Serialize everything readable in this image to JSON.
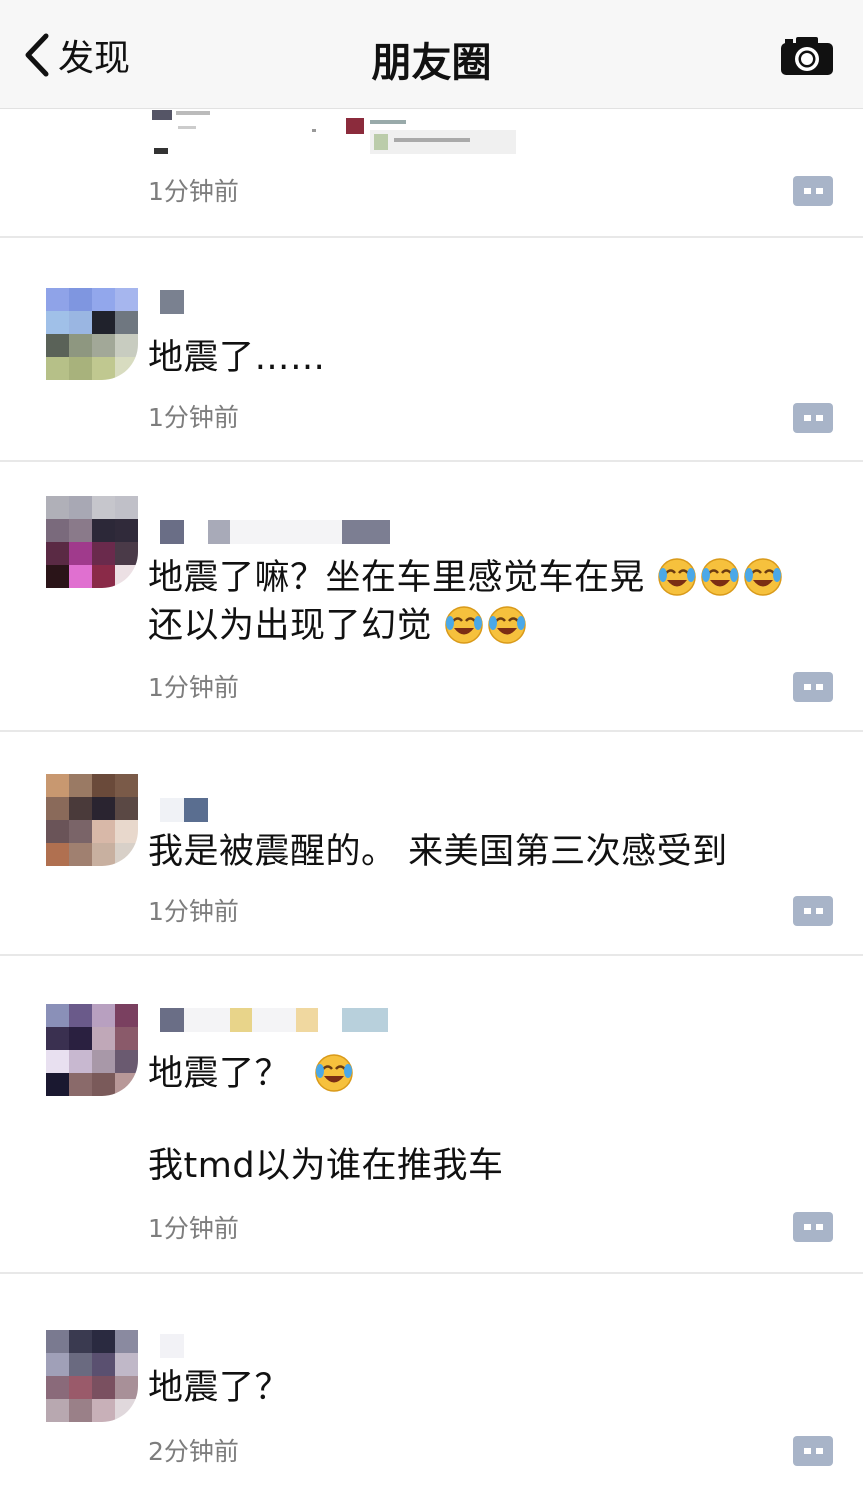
{
  "navbar": {
    "back_label": "发现",
    "title": "朋友圈",
    "back_icon": "chevron-left-icon",
    "camera_icon": "camera-icon"
  },
  "colors": {
    "time": "#7d7d7d",
    "more_button": "#a8b4c8",
    "divider": "#e8e8e8"
  },
  "posts": [
    {
      "content_lines": [],
      "time": "1分钟前"
    },
    {
      "content_lines": [
        "地震了……"
      ],
      "time": "1分钟前"
    },
    {
      "content_lines": [
        "地震了嘛？坐在车里感觉车在晃",
        "还以为出现了幻觉"
      ],
      "time": "1分钟前"
    },
    {
      "content_lines": [
        "我是被震醒的。 来美国第三次感受到"
      ],
      "time": "1分钟前"
    },
    {
      "content_lines": [
        "地震了？",
        "我tmd以为谁在推我车"
      ],
      "time": "1分钟前"
    },
    {
      "content_lines": [
        "地震了？"
      ],
      "time": "2分钟前"
    }
  ]
}
